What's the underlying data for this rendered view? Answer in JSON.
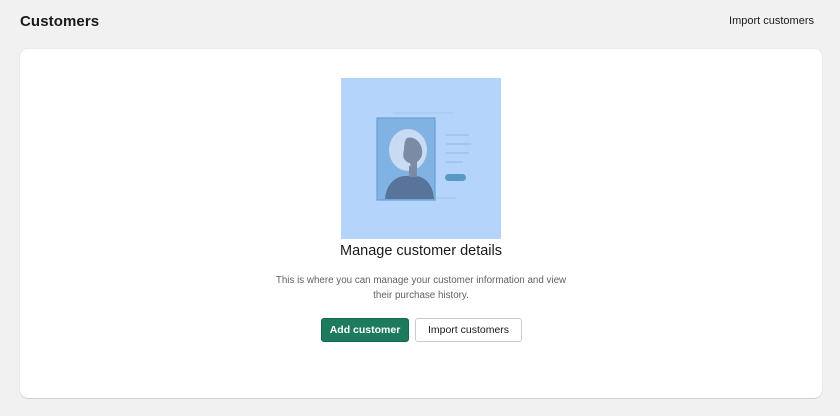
{
  "header": {
    "title": "Customers",
    "action_label": "Import customers"
  },
  "empty_state": {
    "illustration_icon": "customer-profile-illustration",
    "heading": "Manage customer details",
    "body": "This is where you can manage your customer information and view their purchase history.",
    "primary_button": "Add customer",
    "secondary_button": "Import customers"
  },
  "colors": {
    "page_background": "#f1f1f1",
    "card_background": "#ffffff",
    "primary_button": "#1e7a5e",
    "illustration_background": "#b5d4fb"
  }
}
